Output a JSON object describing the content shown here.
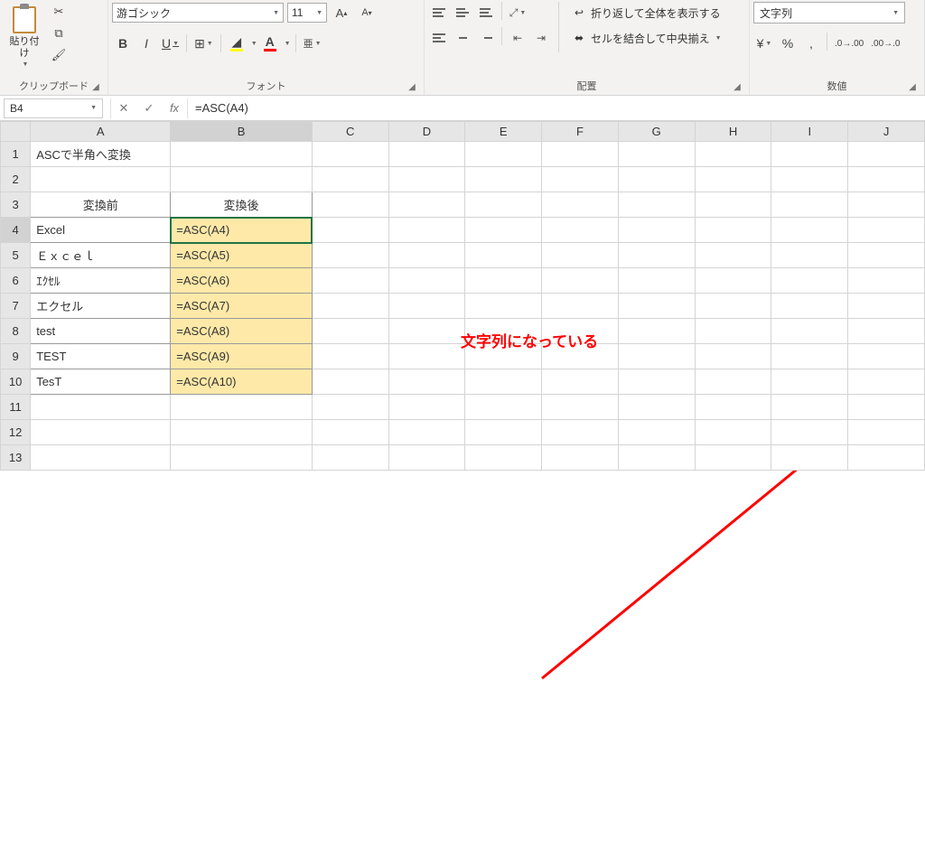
{
  "ribbon": {
    "clipboard": {
      "paste": "貼り付け",
      "label": "クリップボード"
    },
    "font": {
      "family": "游ゴシック",
      "size": "11",
      "bold": "B",
      "italic": "I",
      "underline": "U",
      "label": "フォント"
    },
    "align": {
      "wrap": "折り返して全体を表示する",
      "merge": "セルを結合して中央揃え",
      "label": "配置"
    },
    "number": {
      "format": "文字列",
      "label": "数値"
    }
  },
  "formula_bar": {
    "name_box": "B4",
    "fx": "fx",
    "formula": "=ASC(A4)"
  },
  "columns": [
    "A",
    "B",
    "C",
    "D",
    "E",
    "F",
    "G",
    "H",
    "I",
    "J"
  ],
  "rows": [
    1,
    2,
    3,
    4,
    5,
    6,
    7,
    8,
    9,
    10,
    11,
    12,
    13
  ],
  "cells": {
    "A1": "ASCで半角へ変換",
    "A3": "変換前",
    "B3": "変換後",
    "A4": "Excel",
    "B4": "=ASC(A4)",
    "A5": "Ｅｘｃｅｌ",
    "B5": "=ASC(A5)",
    "A6": "ｴｸｾﾙ",
    "B6": "=ASC(A6)",
    "A7": "エクセル",
    "B7": "=ASC(A7)",
    "A8": "test",
    "B8": "=ASC(A8)",
    "A9": "TEST",
    "B9": "=ASC(A9)",
    "A10": "TesT",
    "B10": "=ASC(A10)"
  },
  "col_widths": {
    "A": 160,
    "B": 160,
    "default": 88
  },
  "annotation": "文字列になっている",
  "selected_cell": "B4"
}
